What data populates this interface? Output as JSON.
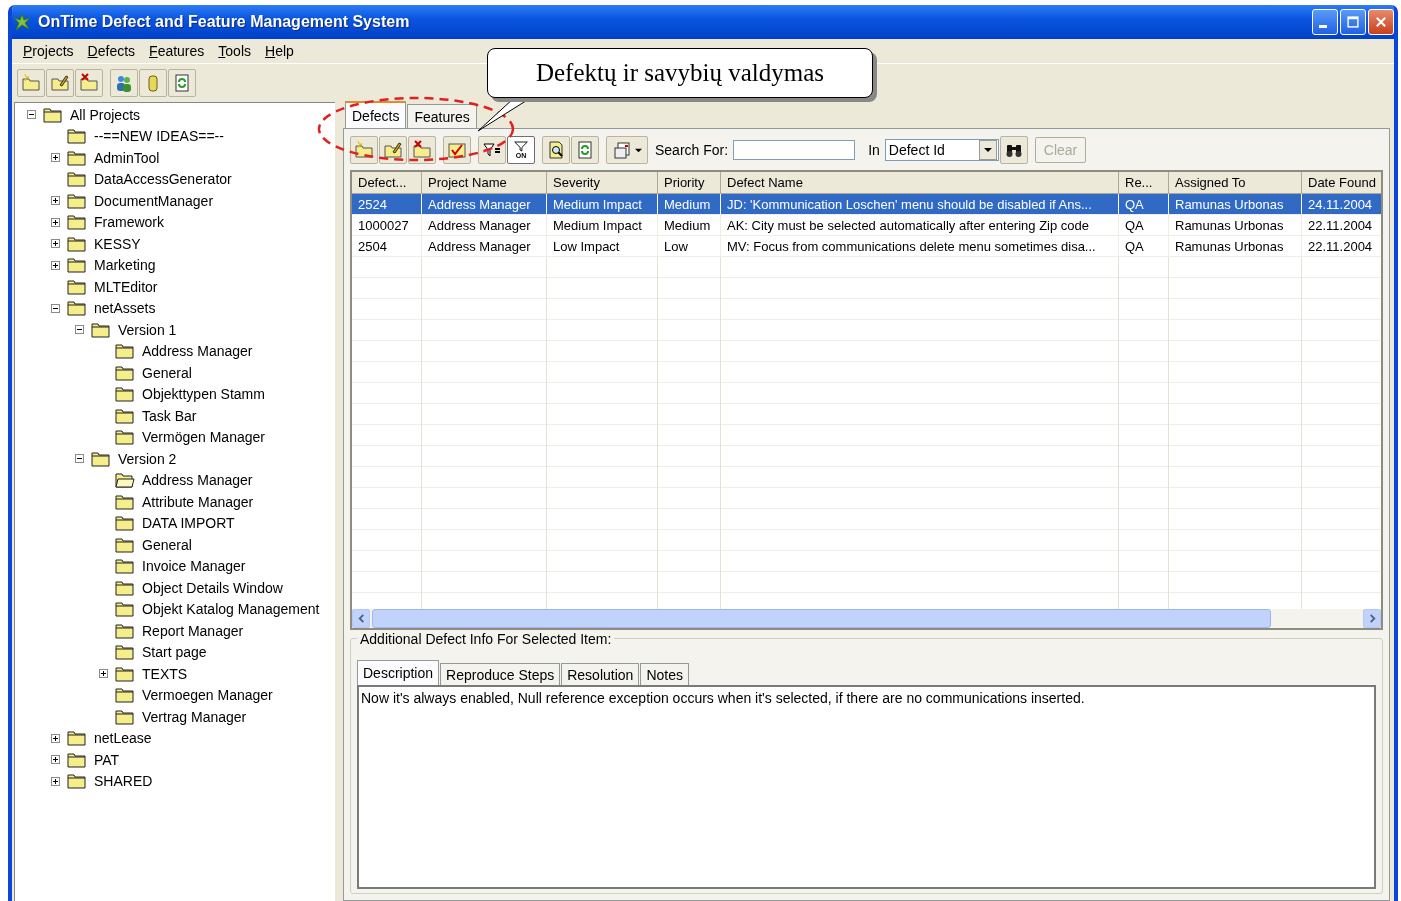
{
  "window": {
    "title": "OnTime Defect and Feature Management System"
  },
  "menu": [
    "Projects",
    "Defects",
    "Features",
    "Tools",
    "Help"
  ],
  "callout": {
    "text": "Defektų ir savybių valdymas"
  },
  "tree": [
    {
      "label": "All Projects",
      "expanded": true,
      "selected": false,
      "children": [
        {
          "label": "--==NEW IDEAS==--",
          "selected": false
        },
        {
          "label": "AdminTool",
          "expanded": false,
          "selected": false
        },
        {
          "label": "DataAccessGenerator",
          "selected": false
        },
        {
          "label": "DocumentManager",
          "expanded": false,
          "selected": false
        },
        {
          "label": "Framework",
          "expanded": false,
          "selected": false
        },
        {
          "label": "KESSY",
          "expanded": false,
          "selected": false
        },
        {
          "label": "Marketing",
          "expanded": false,
          "selected": false
        },
        {
          "label": "MLTEditor",
          "selected": false
        },
        {
          "label": "netAssets",
          "expanded": true,
          "selected": false,
          "children": [
            {
              "label": "Version 1",
              "expanded": true,
              "selected": false,
              "children": [
                {
                  "label": "Address Manager",
                  "selected": false
                },
                {
                  "label": "General",
                  "selected": false
                },
                {
                  "label": "Objekttypen Stamm",
                  "selected": false
                },
                {
                  "label": "Task Bar",
                  "selected": false
                },
                {
                  "label": "Vermögen Manager",
                  "selected": false
                }
              ]
            },
            {
              "label": "Version 2",
              "expanded": true,
              "selected": false,
              "children": [
                {
                  "label": "Address Manager",
                  "selected": true
                },
                {
                  "label": "Attribute Manager",
                  "selected": false
                },
                {
                  "label": "DATA IMPORT",
                  "selected": false
                },
                {
                  "label": "General",
                  "selected": false
                },
                {
                  "label": "Invoice Manager",
                  "selected": false
                },
                {
                  "label": "Object Details Window",
                  "selected": false
                },
                {
                  "label": "Objekt Katalog Management",
                  "selected": false
                },
                {
                  "label": "Report Manager",
                  "selected": false
                },
                {
                  "label": "Start page",
                  "selected": false
                },
                {
                  "label": "TEXTS",
                  "expanded": false,
                  "selected": false
                },
                {
                  "label": "Vermoegen Manager",
                  "selected": false
                },
                {
                  "label": "Vertrag Manager",
                  "selected": false
                }
              ]
            }
          ]
        },
        {
          "label": "netLease",
          "expanded": false,
          "selected": false
        },
        {
          "label": "PAT",
          "expanded": false,
          "selected": false
        },
        {
          "label": "SHARED",
          "expanded": false,
          "selected": false
        }
      ]
    }
  ],
  "tabs": [
    {
      "label": "Defects",
      "selected": true
    },
    {
      "label": "Features",
      "selected": false
    }
  ],
  "filter_toggle": {
    "label": "ON",
    "pressed": true
  },
  "search": {
    "label": "Search For:",
    "in_label": "In",
    "field": "Defect Id",
    "clear_button": {
      "label": "Clear",
      "disabled": true
    }
  },
  "grid": {
    "columns": [
      "Defect...",
      "Project Name",
      "Severity",
      "Priority",
      "Defect Name",
      "Re...",
      "Assigned To",
      "Date Found"
    ],
    "rows": [
      {
        "selected": true,
        "cells": [
          "2524",
          "Address Manager",
          "Medium Impact",
          "Medium",
          "JD: 'Kommunication Loschen' menu should be disabled if Ans...",
          "QA",
          "Ramunas Urbonas",
          "24.11.2004"
        ]
      },
      {
        "selected": false,
        "cells": [
          "1000027",
          "Address Manager",
          "Medium Impact",
          "Medium",
          "AK: City must be selected automatically after entering Zip code",
          "QA",
          "Ramunas Urbonas",
          "22.11.2004"
        ]
      },
      {
        "selected": false,
        "cells": [
          "2504",
          "Address Manager",
          "Low Impact",
          "Low",
          "MV: Focus from communications delete menu sometimes disa...",
          "QA",
          "Ramunas Urbonas",
          "22.11.2004"
        ]
      }
    ]
  },
  "details": {
    "title": "Additional Defect Info For Selected Item:",
    "tabs": [
      {
        "label": "Description",
        "selected": true
      },
      {
        "label": "Reproduce Steps",
        "selected": false
      },
      {
        "label": "Resolution",
        "selected": false
      },
      {
        "label": "Notes",
        "selected": false
      }
    ],
    "text": "Now it's always enabled, Null reference exception occurs when it's selected, if there are no communications inserted."
  }
}
